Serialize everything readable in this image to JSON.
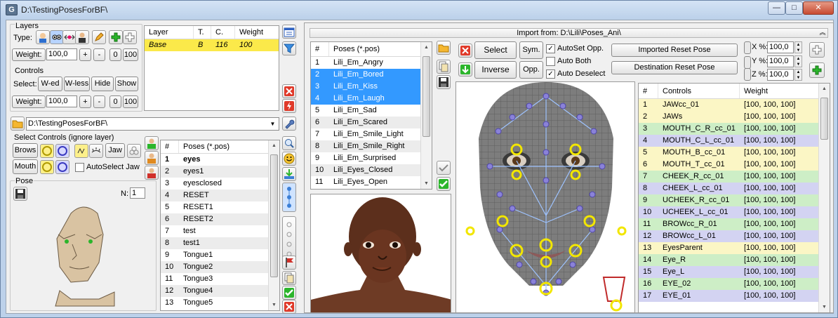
{
  "window": {
    "title": "D:\\TestingPosesForBF\\"
  },
  "layers": {
    "group": "Layers",
    "type_label": "Type:",
    "weight_label": "Weight:",
    "weight_value": "100,0",
    "plus": "+",
    "minus": "-",
    "zero": "0",
    "hundred": "100",
    "columns": [
      "Layer",
      "T.",
      "C.",
      "Weight"
    ],
    "rows": [
      {
        "layer": "Base",
        "t": "B",
        "c": "116",
        "weight": "100"
      }
    ]
  },
  "controls": {
    "group": "Controls",
    "select_label": "Select:",
    "w_ed": "W-ed",
    "w_less": "W-less",
    "hide": "Hide",
    "show": "Show",
    "weight_label": "Weight:",
    "weight_value": "100,0",
    "plus": "+",
    "minus": "-",
    "zero": "0",
    "hundred": "100"
  },
  "path": {
    "value": "D:\\TestingPosesForBF\\"
  },
  "select_controls": {
    "label": "Select Controls (ignore layer)",
    "brows": "Brows",
    "jaw": "Jaw",
    "mouth": "Mouth",
    "autoselect_jaw": "AutoSelect Jaw"
  },
  "pose": {
    "group": "Pose",
    "n_label": "N:",
    "n_value": "1"
  },
  "local_poses": {
    "columns": [
      "#",
      "Poses (*.pos)"
    ],
    "rows": [
      {
        "n": "1",
        "name": "eyes"
      },
      {
        "n": "2",
        "name": "eyes1"
      },
      {
        "n": "3",
        "name": "eyesclosed"
      },
      {
        "n": "4",
        "name": "RESET"
      },
      {
        "n": "5",
        "name": "RESET1"
      },
      {
        "n": "6",
        "name": "RESET2"
      },
      {
        "n": "7",
        "name": "test"
      },
      {
        "n": "8",
        "name": "test1"
      },
      {
        "n": "9",
        "name": "Tongue1"
      },
      {
        "n": "10",
        "name": "Tongue2"
      },
      {
        "n": "11",
        "name": "Tongue3"
      },
      {
        "n": "12",
        "name": "Tongue4"
      },
      {
        "n": "13",
        "name": "Tongue5"
      }
    ]
  },
  "import": {
    "title": "Import from: D:\\Lili\\Poses_Ani\\",
    "columns": [
      "#",
      "Poses (*.pos)"
    ],
    "rows": [
      {
        "n": "1",
        "name": "Lili_Em_Angry"
      },
      {
        "n": "2",
        "name": "Lili_Em_Bored"
      },
      {
        "n": "3",
        "name": "Lili_Em_Kiss"
      },
      {
        "n": "4",
        "name": "Lili_Em_Laugh"
      },
      {
        "n": "5",
        "name": "Lili_Em_Sad"
      },
      {
        "n": "6",
        "name": "Lili_Em_Scared"
      },
      {
        "n": "7",
        "name": "Lili_Em_Smile_Light"
      },
      {
        "n": "8",
        "name": "Lili_Em_Smile_Right"
      },
      {
        "n": "9",
        "name": "Lili_Em_Surprised"
      },
      {
        "n": "10",
        "name": "Lili_Eyes_Closed"
      },
      {
        "n": "11",
        "name": "Lili_Eyes_Open"
      }
    ],
    "select": "Select",
    "inverse": "Inverse",
    "sym": "Sym.",
    "opp": "Opp.",
    "autoset_opp": "AutoSet Opp.",
    "auto_both": "Auto Both",
    "auto_deselect": "Auto Deselect",
    "imported_reset": "Imported Reset Pose",
    "destination_reset": "Destination Reset Pose",
    "x_label": "X %:",
    "y_label": "Y %:",
    "z_label": "Z %:",
    "x_value": "100,0",
    "y_value": "100,0",
    "z_value": "100,0"
  },
  "controls_table": {
    "columns": [
      "#",
      "Controls",
      "Weight"
    ],
    "rows": [
      {
        "n": "1",
        "name": "JAWcc_01",
        "w": "[100, 100, 100]",
        "color": "#fbf6c5"
      },
      {
        "n": "2",
        "name": "JAWs",
        "w": "[100, 100, 100]",
        "color": "#fbf6c5"
      },
      {
        "n": "3",
        "name": "MOUTH_C_R_cc_01",
        "w": "[100, 100, 100]",
        "color": "#cdeec6"
      },
      {
        "n": "4",
        "name": "MOUTH_C_L_cc_01",
        "w": "[100, 100, 100]",
        "color": "#d3d3f2"
      },
      {
        "n": "5",
        "name": "MOUTH_B_cc_01",
        "w": "[100, 100, 100]",
        "color": "#fbf6c5"
      },
      {
        "n": "6",
        "name": "MOUTH_T_cc_01",
        "w": "[100, 100, 100]",
        "color": "#fbf6c5"
      },
      {
        "n": "7",
        "name": "CHEEK_R_cc_01",
        "w": "[100, 100, 100]",
        "color": "#cdeec6"
      },
      {
        "n": "8",
        "name": "CHEEK_L_cc_01",
        "w": "[100, 100, 100]",
        "color": "#d3d3f2"
      },
      {
        "n": "9",
        "name": "UCHEEK_R_cc_01",
        "w": "[100, 100, 100]",
        "color": "#cdeec6"
      },
      {
        "n": "10",
        "name": "UCHEEK_L_cc_01",
        "w": "[100, 100, 100]",
        "color": "#d3d3f2"
      },
      {
        "n": "11",
        "name": "BROWcc_R_01",
        "w": "[100, 100, 100]",
        "color": "#cdeec6"
      },
      {
        "n": "12",
        "name": "BROWcc_L_01",
        "w": "[100, 100, 100]",
        "color": "#d3d3f2"
      },
      {
        "n": "13",
        "name": "EyesParent",
        "w": "[100, 100, 100]",
        "color": "#fbf6c5"
      },
      {
        "n": "14",
        "name": "Eye_R",
        "w": "[100, 100, 100]",
        "color": "#cdeec6"
      },
      {
        "n": "15",
        "name": "Eye_L",
        "w": "[100, 100, 100]",
        "color": "#d3d3f2"
      },
      {
        "n": "16",
        "name": "EYE_02",
        "w": "[100, 100, 100]",
        "color": "#cdeec6"
      },
      {
        "n": "17",
        "name": "EYE_01",
        "w": "[100, 100, 100]",
        "color": "#d3d3f2"
      }
    ]
  },
  "colors": {
    "selection": "#3399ff",
    "layer_highlight": "#fbe94a",
    "yellow_ring": "#f2e600",
    "node": "#8a82d8"
  }
}
